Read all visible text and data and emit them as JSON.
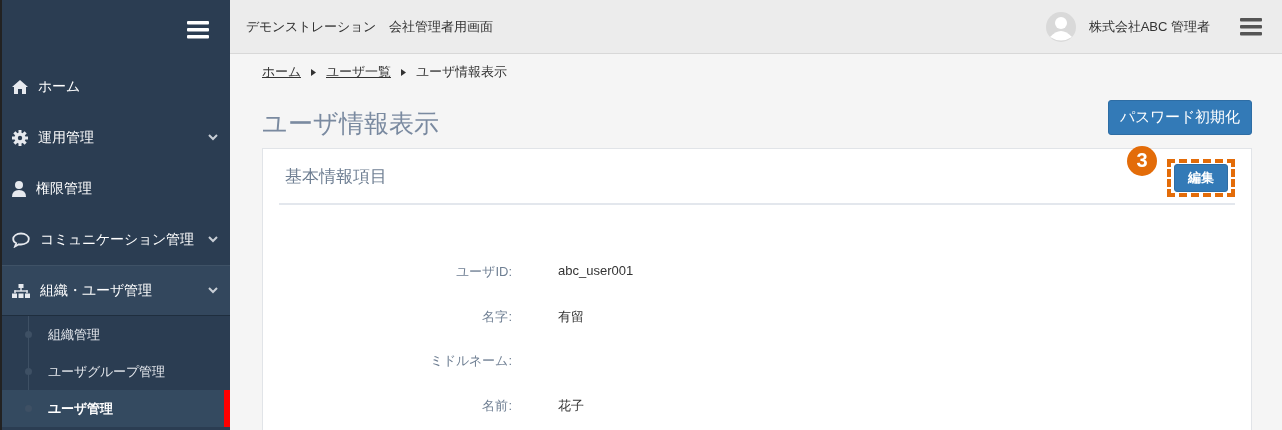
{
  "header": {
    "title": "デモンストレーション　会社管理者用画面",
    "user": "株式会社ABC 管理者"
  },
  "sidebar": {
    "items": [
      {
        "kind": "home",
        "label": "ホーム",
        "expandable": false,
        "expanded": false
      },
      {
        "kind": "gear",
        "label": "運用管理",
        "expandable": true,
        "expanded": false
      },
      {
        "kind": "user",
        "label": "権限管理",
        "expandable": false,
        "expanded": false
      },
      {
        "kind": "comment",
        "label": "コミュニケーション管理",
        "expandable": true,
        "expanded": false
      },
      {
        "kind": "sitemap",
        "label": "組織・ユーザ管理",
        "expandable": true,
        "expanded": true,
        "children": [
          {
            "label": "組織管理",
            "selected": false
          },
          {
            "label": "ユーザグループ管理",
            "selected": false
          },
          {
            "label": "ユーザ管理",
            "selected": true
          }
        ]
      }
    ]
  },
  "breadcrumb": [
    {
      "label": "ホーム",
      "link": true
    },
    {
      "label": "ユーザ一覧",
      "link": true
    },
    {
      "label": "ユーザ情報表示",
      "link": false
    }
  ],
  "page_title": "ユーザ情報表示",
  "password_reset_button": "パスワード初期化",
  "card": {
    "title": "基本情報項目",
    "edit_button": {
      "label": "編集",
      "annotation": "3"
    },
    "fields": [
      {
        "label": "ユーザID:",
        "value": "abc_user001"
      },
      {
        "label": "名字:",
        "value": "有留"
      },
      {
        "label": "ミドルネーム:"
      },
      {
        "label": "名前:",
        "value": "花子"
      }
    ]
  }
}
